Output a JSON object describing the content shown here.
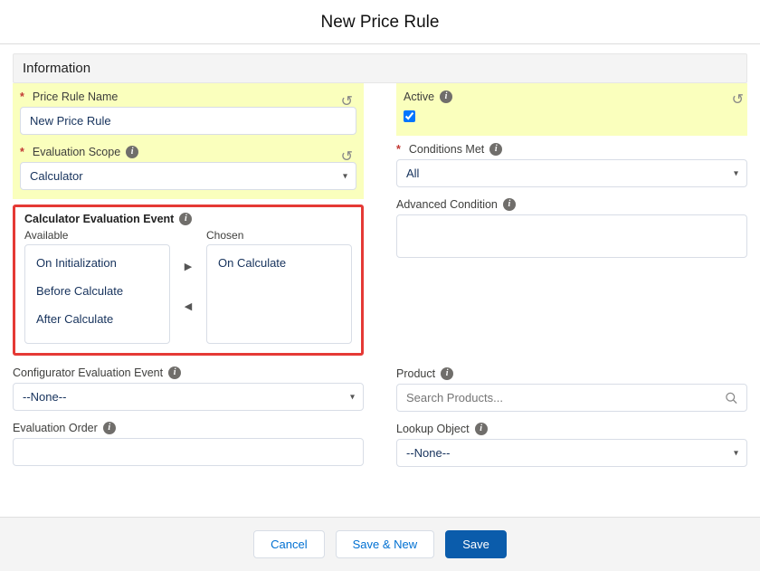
{
  "header": {
    "title": "New Price Rule"
  },
  "section": {
    "title": "Information"
  },
  "icons": {
    "info": "i",
    "undo": "↺",
    "caret": "▾",
    "right": "▶",
    "left": "◀"
  },
  "left": {
    "priceRuleName": {
      "label": "Price Rule Name",
      "value": "New Price Rule"
    },
    "evaluationScope": {
      "label": "Evaluation Scope",
      "value": "Calculator"
    },
    "calcEvalEvent": {
      "label": "Calculator Evaluation Event",
      "availableLabel": "Available",
      "chosenLabel": "Chosen",
      "available": [
        "On Initialization",
        "Before Calculate",
        "After Calculate"
      ],
      "chosen": [
        "On Calculate"
      ]
    },
    "configEvalEvent": {
      "label": "Configurator Evaluation Event",
      "value": "--None--"
    },
    "evalOrder": {
      "label": "Evaluation Order",
      "value": ""
    }
  },
  "right": {
    "active": {
      "label": "Active",
      "checked": true
    },
    "conditionsMet": {
      "label": "Conditions Met",
      "value": "All"
    },
    "advancedCondition": {
      "label": "Advanced Condition",
      "value": ""
    },
    "product": {
      "label": "Product",
      "placeholder": "Search Products..."
    },
    "lookupObject": {
      "label": "Lookup Object",
      "value": "--None--"
    }
  },
  "footer": {
    "cancel": "Cancel",
    "saveNew": "Save & New",
    "save": "Save"
  }
}
